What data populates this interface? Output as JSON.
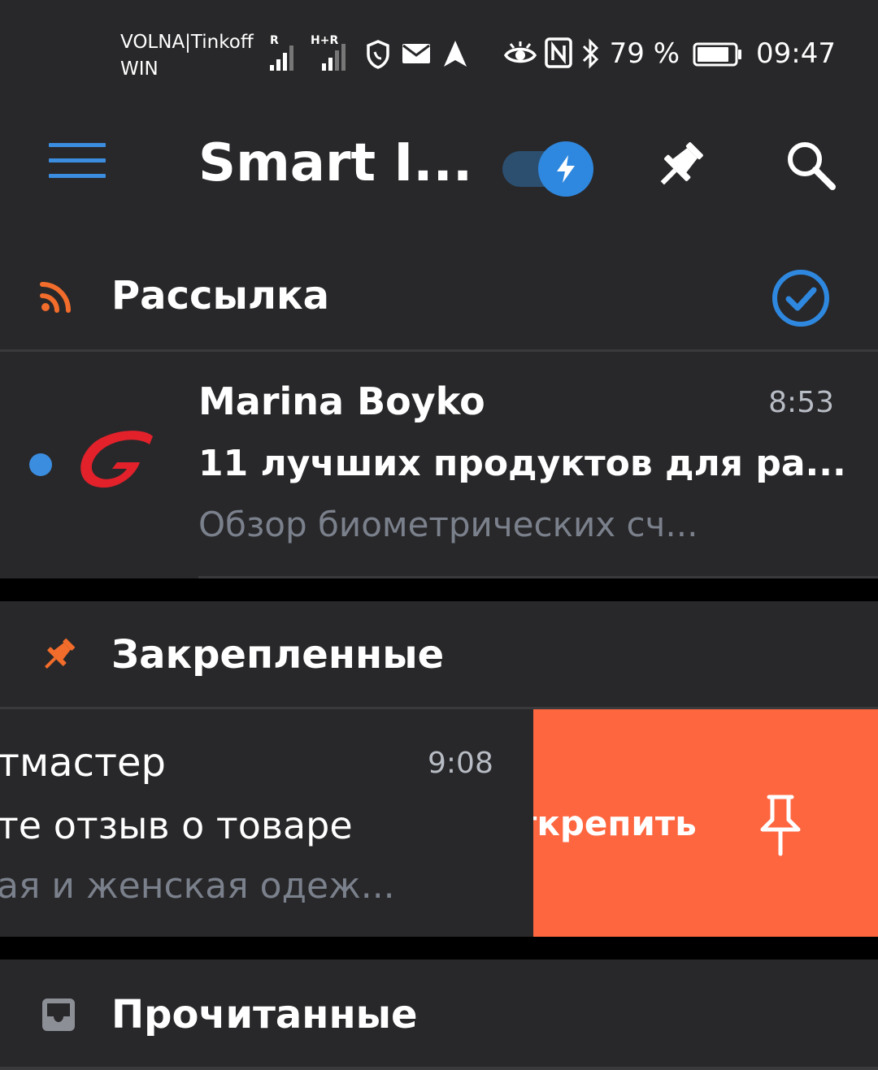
{
  "status_bar": {
    "carrier_line1": "VOLNA|Tinkoff",
    "carrier_line2": "WIN",
    "signal1_label": "R",
    "signal2_label": "H+R",
    "battery": "79 %",
    "time": "09:47",
    "icons_left": [
      "signal-icon",
      "signal-icon",
      "shield-icon",
      "mail-icon",
      "location-arrow-icon"
    ],
    "icons_right": [
      "eye-icon",
      "nfc-icon",
      "bluetooth-icon",
      "battery-icon"
    ]
  },
  "app_bar": {
    "title": "Smart I...",
    "toggle_on": true,
    "accent": "#2f88df"
  },
  "sections": {
    "mailing": {
      "title": "Рассылка",
      "icon": "rss-icon",
      "icon_color": "#f26c2b",
      "check_color": "#2f88df"
    },
    "pinned": {
      "title": "Закрепленные",
      "icon": "pin-icon",
      "icon_color": "#f26c2b"
    },
    "read": {
      "title": "Прочитанные",
      "icon": "inbox-icon"
    }
  },
  "messages": {
    "mailing_item": {
      "sender": "Marina Boyko",
      "time": "8:53",
      "subject": "11 лучших продуктов для ра...",
      "preview": "Обзор биометрических сч...",
      "unread": true,
      "avatar_color": "#e2212b"
    },
    "pinned_item": {
      "sender": "тмастер",
      "time": "9:08",
      "subject": "те отзыв о товаре",
      "preview": "ая и женская одеж...",
      "swipe_action_label": "ткрепить",
      "swipe_color": "#fe6640"
    }
  }
}
